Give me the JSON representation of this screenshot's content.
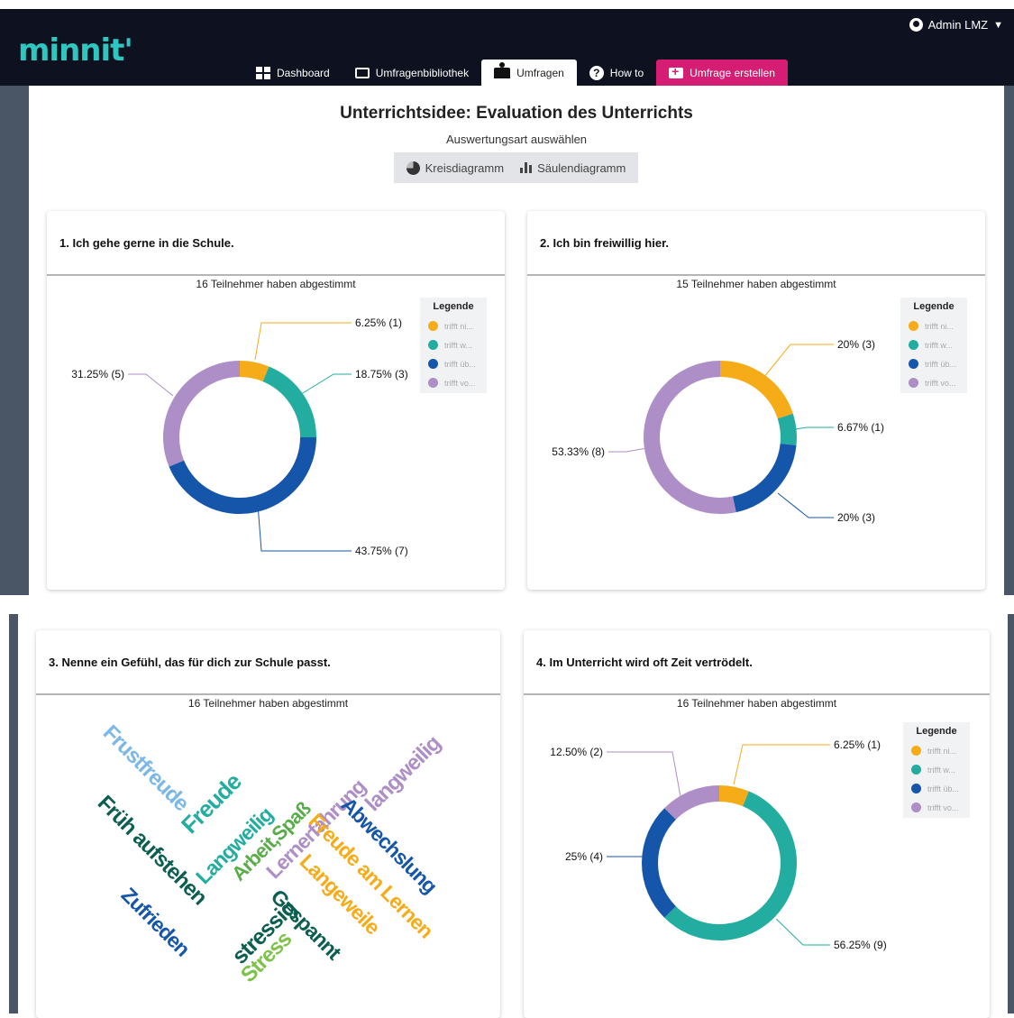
{
  "app": {
    "logo": "minnit'",
    "user": "Admin LMZ"
  },
  "nav": [
    {
      "label": "Dashboard",
      "icon": "dashboard-icon"
    },
    {
      "label": "Umfragenbibliothek",
      "icon": "folder-icon"
    },
    {
      "label": "Umfragen",
      "icon": "reader-icon",
      "active": true
    },
    {
      "label": "How to",
      "icon": "help-icon"
    },
    {
      "label": "Umfrage erstellen",
      "icon": "new-folder-icon"
    }
  ],
  "page": {
    "title": "Unterrichtsidee: Evaluation des Unterrichts",
    "subtitle": "Auswertungsart auswählen",
    "view_options": [
      "Kreisdiagramm",
      "Säulendiagramm"
    ]
  },
  "colors": {
    "c1": "#f5ac18",
    "c2": "#22ada0",
    "c3": "#1656aa",
    "c4": "#ad8ec6",
    "brand": "#2ec7c0",
    "accent": "#d61d74"
  },
  "legend": {
    "title": "Legende",
    "items": [
      "trifft ni...",
      "trifft w...",
      "trifft üb...",
      "trifft vo..."
    ]
  },
  "questions": [
    {
      "title": "1. Ich gehe gerne in die Schule.",
      "votes": "16 Teilnehmer haben abgestimmt"
    },
    {
      "title": "2. Ich bin freiwillig hier.",
      "votes": "15 Teilnehmer haben abgestimmt"
    },
    {
      "title": "3. Nenne ein Gefühl, das für dich zur Schule passt.",
      "votes": "16 Teilnehmer haben abgestimmt"
    },
    {
      "title": "4. Im Unterricht wird oft Zeit vertrödelt.",
      "votes": "16 Teilnehmer haben abgestimmt"
    }
  ],
  "chart_data": [
    {
      "type": "pie",
      "categories": [
        "trifft ni...",
        "trifft w...",
        "trifft üb...",
        "trifft vo..."
      ],
      "values": [
        1,
        3,
        7,
        5
      ],
      "labels": [
        "6.25% (1)",
        "18.75% (3)",
        "43.75% (7)",
        "31.25% (5)"
      ]
    },
    {
      "type": "pie",
      "categories": [
        "trifft ni...",
        "trifft w...",
        "trifft üb...",
        "trifft vo..."
      ],
      "values": [
        3,
        1,
        3,
        8
      ],
      "labels": [
        "20% (3)",
        "6.67% (1)",
        "20% (3)",
        "53.33% (8)"
      ]
    },
    {
      "type": "pie",
      "categories": [
        "trifft ni...",
        "trifft w...",
        "trifft üb...",
        "trifft vo..."
      ],
      "values": [
        1,
        9,
        4,
        2
      ],
      "labels": [
        "6.25% (1)",
        "56.25% (9)",
        "25% (4)",
        "12.50% (2)"
      ]
    }
  ],
  "wordcloud": [
    {
      "text": "Frustfreude",
      "color": "#7cb8e6"
    },
    {
      "text": "Freude",
      "color": "#22ada0"
    },
    {
      "text": "Langweilig",
      "color": "#22ada0"
    },
    {
      "text": "Früh aufstehen",
      "color": "#0c5e50"
    },
    {
      "text": "Arbeit,Spaß",
      "color": "#5aac4a"
    },
    {
      "text": "Lernerfahrung",
      "color": "#ad8ec6"
    },
    {
      "text": "langweilig",
      "color": "#ad8ec6"
    },
    {
      "text": "Abwechslung",
      "color": "#1656aa"
    },
    {
      "text": "Freude am Lernen",
      "color": "#f5ac18"
    },
    {
      "text": "Langeweile",
      "color": "#f5ac18"
    },
    {
      "text": "Zufrieden",
      "color": "#1656aa"
    },
    {
      "text": "stressig",
      "color": "#0c5e50"
    },
    {
      "text": "Stress",
      "color": "#7ec24a"
    },
    {
      "text": "Gespannt",
      "color": "#0c5e50"
    }
  ]
}
